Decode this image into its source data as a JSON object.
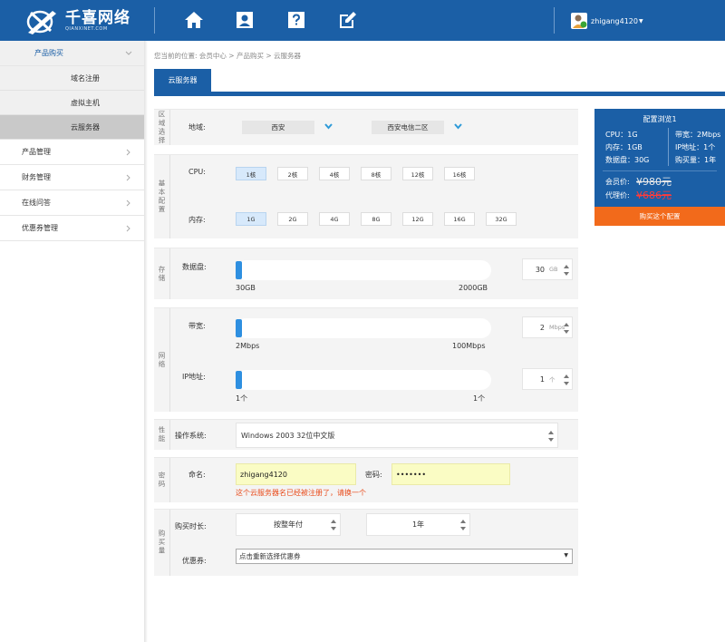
{
  "header": {
    "logo_cn": "千喜网络",
    "logo_en": "QIANXINET.COM",
    "nav_icons": [
      "home-icon",
      "user-icon",
      "help-icon",
      "edit-icon"
    ],
    "username": "zhigang4120",
    "bg_color": "#1b5fa6"
  },
  "sidebar": {
    "items": [
      {
        "label": "产品购买",
        "open": true
      },
      {
        "label": "域名注册",
        "sub": true
      },
      {
        "label": "虚拟主机",
        "sub": true
      },
      {
        "label": "云服务器",
        "sub": true,
        "active": true
      },
      {
        "label": "产品管理"
      },
      {
        "label": "财务管理"
      },
      {
        "label": "在线问答"
      },
      {
        "label": "优惠券管理"
      }
    ]
  },
  "breadcrumb": "您当前的位置: 会员中心 > 产品购买 > 云服务器",
  "tab": {
    "label": "云服务器"
  },
  "region": {
    "section": "区域选择",
    "label": "地域:",
    "city": "西安",
    "zone": "西安电信二区"
  },
  "basic": {
    "section": "基本配置",
    "cpu_label": "CPU:",
    "cpu_options": [
      "1核",
      "2核",
      "4核",
      "8核",
      "12核",
      "16核"
    ],
    "cpu_selected": "1核",
    "mem_label": "内存:",
    "mem_options": [
      "1G",
      "2G",
      "4G",
      "8G",
      "12G",
      "16G",
      "32G"
    ],
    "mem_selected": "1G"
  },
  "storage": {
    "section": "存储",
    "disk_label": "数据盘:",
    "min": "30GB",
    "max": "2000GB",
    "value": "30",
    "unit": "GB",
    "level": 0
  },
  "network": {
    "section": "网络",
    "bw_label": "带宽:",
    "bw_min": "2Mbps",
    "bw_max": "100Mbps",
    "bw_value": "2",
    "bw_unit": "Mbps",
    "ip_label": "IP地址:",
    "ip_min": "1个",
    "ip_max": "1个",
    "ip_value": "1",
    "ip_unit": "个"
  },
  "performance": {
    "section": "性能",
    "os_label": "操作系统:",
    "os_value": "Windows 2003 32位中文版"
  },
  "password": {
    "section": "密码",
    "name_label": "命名:",
    "name_value": "zhigang4120",
    "pwd_label": "密码:",
    "pwd_value": "•••••••",
    "error": "这个云服务器名已经被注册了，请换一个"
  },
  "purchase": {
    "section": "购买量",
    "duration_label": "购买时长:",
    "duration_mode": "按整年付",
    "duration_value": "1年",
    "coupon_label": "优惠券:",
    "coupon_value": "点击重新选择优惠券"
  },
  "summary": {
    "title": "配置浏览1",
    "cpu": "CPU：1G",
    "mem": "内存：1GB",
    "disk": "数据盘：30G",
    "bw": "带宽：2Mbps",
    "ip": "IP地址：1个",
    "qty": "购买量：1年",
    "member_label": "会员价:",
    "member_price": "¥980元",
    "agent_label": "代理价:",
    "agent_price": "¥686元",
    "buy_button": "购买这个配置"
  }
}
